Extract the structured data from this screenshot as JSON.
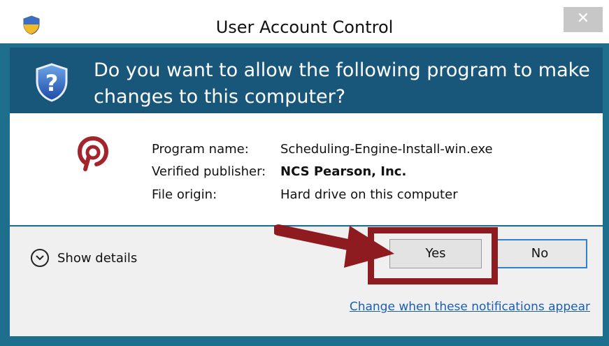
{
  "window": {
    "title": "User Account Control",
    "close_label": "✕"
  },
  "banner": {
    "question": "Do you want to allow the following program to make changes to this computer?"
  },
  "program": {
    "rows": [
      {
        "label": "Program name:",
        "value": "Scheduling-Engine-Install-win.exe",
        "bold": false
      },
      {
        "label": "Verified publisher:",
        "value": "NCS Pearson, Inc.",
        "bold": true
      },
      {
        "label": "File origin:",
        "value": "Hard drive on this computer",
        "bold": false
      }
    ]
  },
  "footer": {
    "details_label": "Show details",
    "yes_label": "Yes",
    "no_label": "No",
    "link_label": "Change when these notifications appear"
  },
  "colors": {
    "banner_bg": "#19577a",
    "highlight": "#8e1b1f",
    "link": "#1a5fb4",
    "focus_border": "#2f7fd2"
  },
  "icons": {
    "title_icon": "uac-shield-icon",
    "banner_icon": "uac-question-shield-icon",
    "program_icon": "pearson-logo-icon",
    "details_icon": "chevron-down-circle-icon",
    "annotation": "red-arrow-icon"
  }
}
